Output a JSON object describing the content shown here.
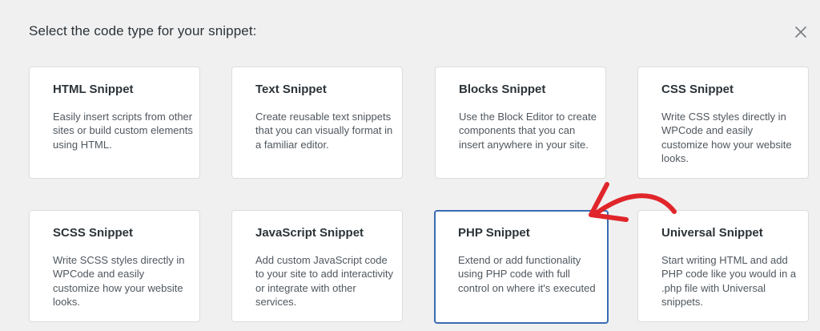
{
  "header": {
    "title": "Select the code type for your snippet:"
  },
  "cards": [
    {
      "title": "HTML Snippet",
      "description": "Easily insert scripts from other sites or build custom elements using HTML."
    },
    {
      "title": "Text Snippet",
      "description": "Create reusable text snippets that you can visually format in a familiar editor."
    },
    {
      "title": "Blocks Snippet",
      "description": "Use the Block Editor to create components that you can insert anywhere in your site."
    },
    {
      "title": "CSS Snippet",
      "description": "Write CSS styles directly in WPCode and easily customize how your website looks."
    },
    {
      "title": "SCSS Snippet",
      "description": "Write SCSS styles directly in WPCode and easily customize how your website looks."
    },
    {
      "title": "JavaScript Snippet",
      "description": "Add custom JavaScript code to your site to add interactivity or integrate with other services."
    },
    {
      "title": "PHP Snippet",
      "description": "Extend or add functionality using PHP code with full control on where it's executed"
    },
    {
      "title": "Universal Snippet",
      "description": "Start writing HTML and add PHP code like you would in a .php file with Universal snippets."
    }
  ],
  "selected_card": "PHP Snippet",
  "colors": {
    "selected_border": "#3a6bb3",
    "arrow": "#e0262b",
    "background": "#f0f0f1"
  },
  "icons": {
    "close": "close-icon",
    "annotation": "red-arrow-icon"
  }
}
